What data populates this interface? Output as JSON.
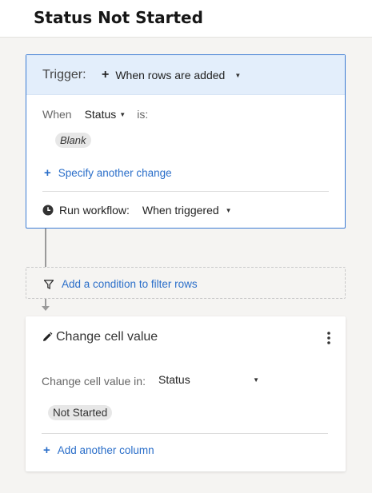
{
  "header": {
    "title": "Status Not Started"
  },
  "trigger": {
    "label": "Trigger:",
    "event": "When rows are added",
    "when_label": "When",
    "field": "Status",
    "is_label": "is:",
    "value_chip": "Blank",
    "specify_link": "Specify another change",
    "run_label": "Run workflow:",
    "run_value": "When triggered"
  },
  "condition": {
    "link": "Add a condition to filter rows"
  },
  "action": {
    "title": "Change cell value",
    "change_in_label": "Change cell value in:",
    "column": "Status",
    "value_chip": "Not Started",
    "add_column_link": "Add another column"
  },
  "colors": {
    "accent": "#2a6ec9",
    "trigger_border": "#3b7bd4",
    "trigger_header_bg": "#e3eefb"
  },
  "icons": [
    "plus-icon",
    "caret-down-icon",
    "clock-icon",
    "filter-icon",
    "pencil-icon",
    "more-vertical-icon",
    "arrow-down-icon"
  ]
}
